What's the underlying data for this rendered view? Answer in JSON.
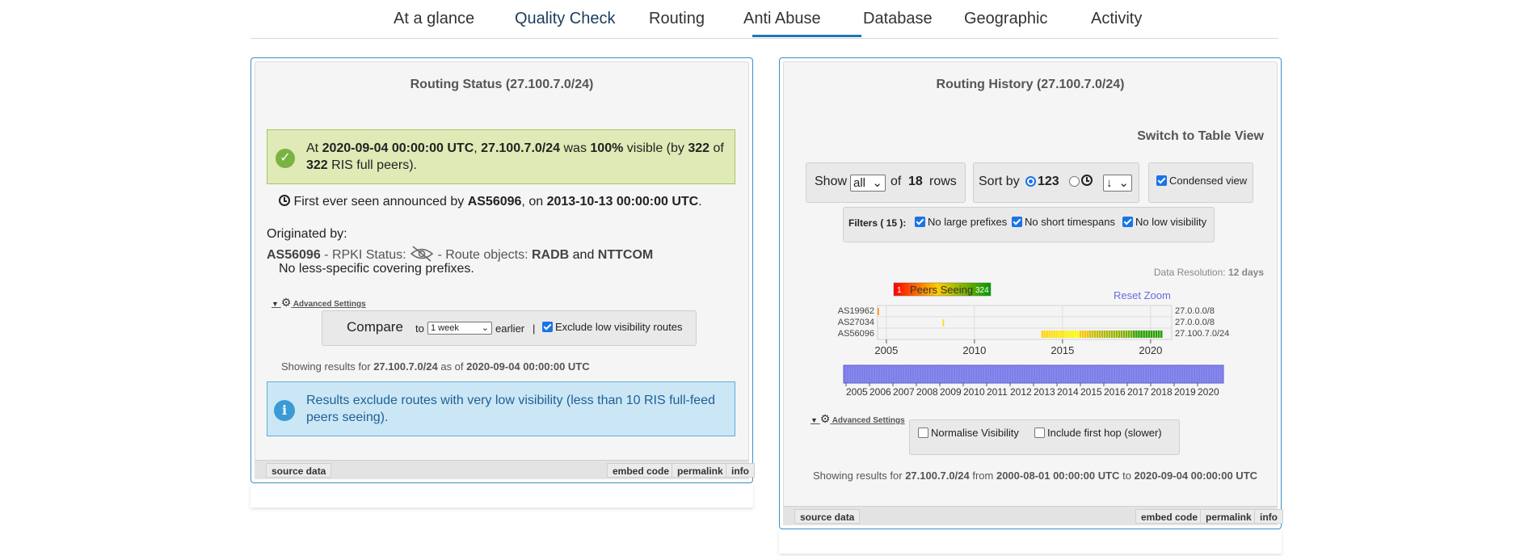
{
  "nav": {
    "tabs": [
      "At a glance",
      "Quality Check",
      "Routing",
      "Anti Abuse",
      "Database",
      "Geographic",
      "Activity"
    ],
    "active": "Quality Check"
  },
  "left_widget": {
    "title": "Routing Status (27.100.7.0/24)",
    "status": {
      "at": "At",
      "time": "2020-09-04 00:00:00 UTC",
      "comma": ",",
      "prefix": "27.100.7.0/24",
      "was": "was",
      "percent": "100%",
      "visible_by": "visible (by",
      "seen": "322",
      "of": "of",
      "total": "322",
      "tail": "RIS full peers)."
    },
    "first_seen": {
      "text": "First ever seen announced by",
      "asn": "AS56096",
      "on": ", on",
      "date": "2013-10-13 00:00:00 UTC",
      "end": "."
    },
    "originated_by": "Originated by:",
    "origin": {
      "asn": "AS56096",
      "rpki_label": "- RPKI Status:",
      "route_objects": "- Route objects:",
      "db1": "RADB",
      "and": "and",
      "db2": "NTTCOM"
    },
    "no_less_specific": "No less-specific covering prefixes.",
    "advanced_settings": "Advanced Settings",
    "compare": {
      "label": "Compare",
      "to": "to",
      "period": "1 week",
      "earlier": "earlier",
      "sep": "|",
      "exclude_label": "Exclude low visibility routes",
      "exclude_checked": true
    },
    "showing": {
      "prefix_text": "Showing results for",
      "resource": "27.100.7.0/24",
      "as_of": "as of",
      "time": "2020-09-04 00:00:00 UTC"
    },
    "info_message": "Results exclude routes with very low visibility (less than 10 RIS full-feed peers seeing).",
    "footer": {
      "source": "source data",
      "embed": "embed code",
      "permalink": "permalink",
      "info": "info"
    }
  },
  "right_widget": {
    "title": "Routing History (27.100.7.0/24)",
    "switch_view": "Switch to Table View",
    "show": {
      "label": "Show",
      "value": "all",
      "of": "of",
      "count": "18",
      "rows": "rows"
    },
    "sort": {
      "label": "Sort by",
      "option1": "123",
      "direction": "↓"
    },
    "condensed": {
      "label": "Condensed view",
      "checked": true
    },
    "filters": {
      "label": "Filters ( 15 ):",
      "items": [
        "No large prefixes",
        "No short timespans",
        "No low visibility"
      ]
    },
    "data_resolution": {
      "label": "Data Resolution:",
      "value": "12 days"
    },
    "reset_zoom": "Reset Zoom",
    "advanced_settings": "Advanced Settings",
    "normalise": "Normalise Visibility",
    "first_hop": "Include first hop (slower)",
    "showing": {
      "prefix_text": "Showing results for",
      "resource": "27.100.7.0/24",
      "from": "from",
      "start": "2000-08-01 00:00:00 UTC",
      "to": "to",
      "end": "2020-09-04 00:00:00 UTC"
    },
    "footer": {
      "source": "source data",
      "embed": "embed code",
      "permalink": "permalink",
      "info": "info"
    },
    "colors": {
      "accent": "#3b8fc6",
      "timeline": "#8b8bf0",
      "gradient_low": "#ff0000",
      "gradient_high": "#00aa00"
    }
  },
  "chart_data": {
    "type": "heatmap",
    "legend": {
      "min": "1",
      "label": "Peers Seeing",
      "max": "324"
    },
    "rows": [
      {
        "asn": "AS19962",
        "prefix": "27.0.0.0/8"
      },
      {
        "asn": "AS27034",
        "prefix": "27.0.0.0/8"
      },
      {
        "asn": "AS56096",
        "prefix": "27.100.7.0/24"
      }
    ],
    "x_ticks": [
      "2005",
      "2010",
      "2015",
      "2020"
    ],
    "xlim": [
      2004.5,
      2021.2
    ],
    "navigator_ticks": [
      "2005",
      "2006",
      "2007",
      "2008",
      "2009",
      "2010",
      "2011",
      "2012",
      "2013",
      "2014",
      "2015",
      "2016",
      "2017",
      "2018",
      "2019",
      "2020"
    ],
    "segments": [
      {
        "row": 0,
        "from": 2004.5,
        "to": 2004.6,
        "level": 0.0
      },
      {
        "row": 1,
        "from": 2008.2,
        "to": 2008.3,
        "level": 0.35
      },
      {
        "row": 2,
        "from": 2013.8,
        "to": 2016.5,
        "level": 0.3
      },
      {
        "row": 2,
        "from": 2016.5,
        "to": 2019.0,
        "level": 0.6
      },
      {
        "row": 2,
        "from": 2019.0,
        "to": 2020.7,
        "level": 0.95
      }
    ]
  }
}
